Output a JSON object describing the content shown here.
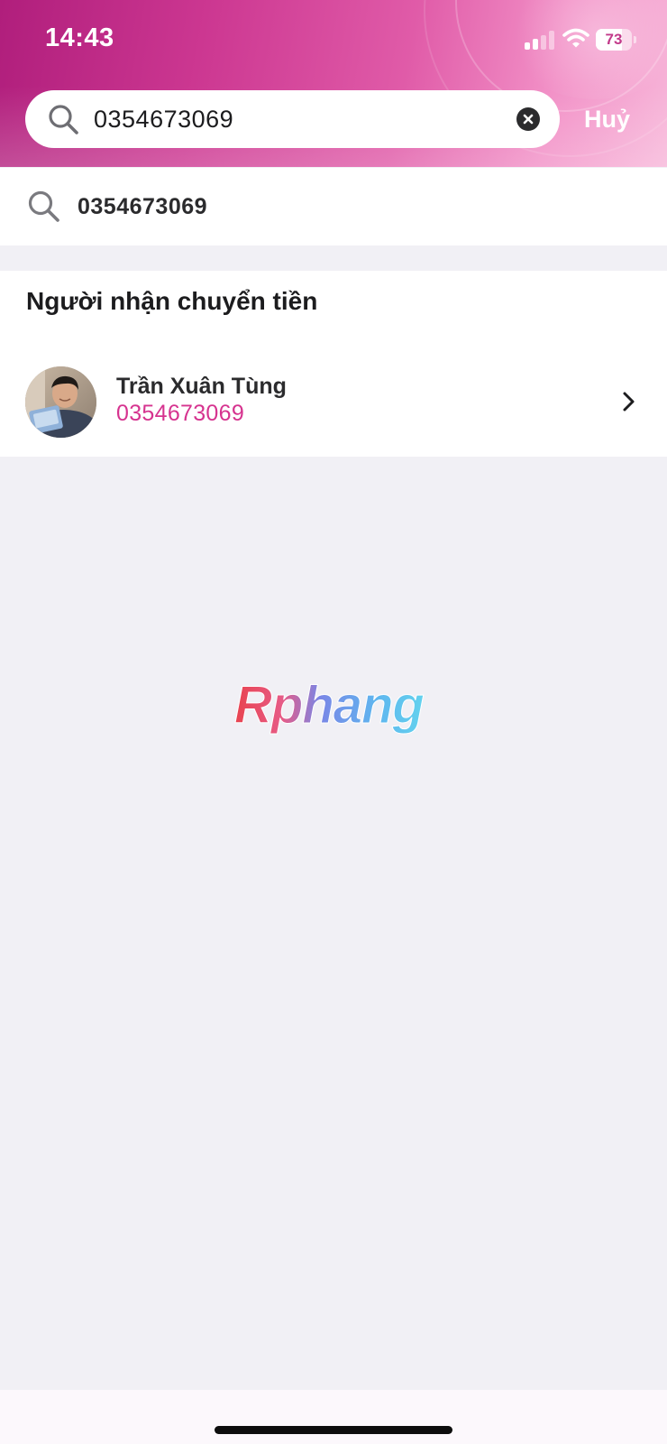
{
  "status_bar": {
    "time": "14:43",
    "battery_level": "73",
    "battery_fraction": 0.73,
    "signal_bars_active": 2,
    "signal_bars_total": 4,
    "icons": [
      "signal-icon",
      "wifi-icon",
      "battery-icon"
    ]
  },
  "search": {
    "value": "0354673069",
    "cancel_label": "Huỷ",
    "icons": [
      "search-icon",
      "clear-icon"
    ]
  },
  "suggestion": {
    "text": "0354673069",
    "icon": "search-icon"
  },
  "recipients": {
    "title": "Người nhận chuyển tiền",
    "items": [
      {
        "name": "Trần Xuân Tùng",
        "phone": "0354673069",
        "icon": "chevron-right-icon"
      }
    ]
  },
  "watermark": {
    "text": "Rphang"
  },
  "colors": {
    "header_start": "#b01e7c",
    "header_end": "#f7b6d9",
    "accent": "#d6338f",
    "page_background": "#f1f0f5",
    "text_primary": "#1c1c1e"
  }
}
